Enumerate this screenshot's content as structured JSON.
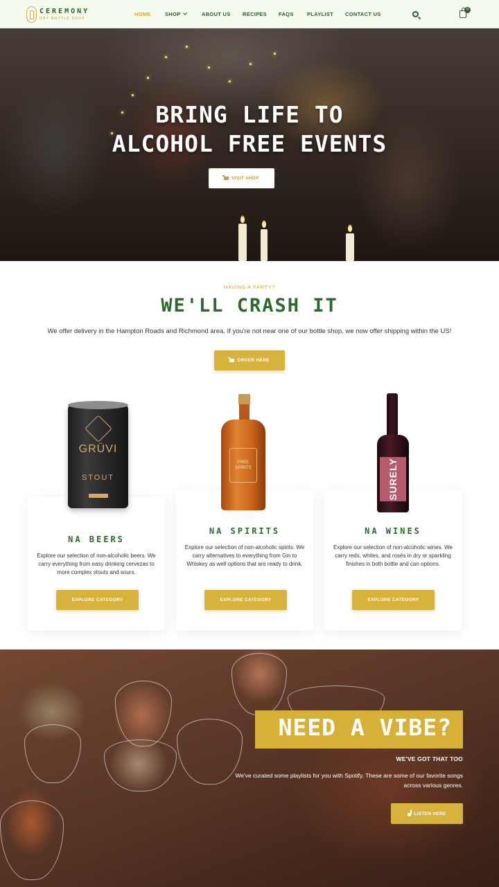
{
  "brand": {
    "title": "CEREMONY",
    "subtitle": "DRY BOTTLE SHOP"
  },
  "nav": {
    "items": [
      {
        "label": "HOME"
      },
      {
        "label": "SHOP"
      },
      {
        "label": "ABOUT US"
      },
      {
        "label": "RECIPES"
      },
      {
        "label": "FAQS"
      },
      {
        "label": "PLAYLIST"
      },
      {
        "label": "CONTACT US"
      }
    ],
    "cart_count": "0"
  },
  "hero": {
    "title_line1": "BRING LIFE TO",
    "title_line2": "ALCOHOL FREE EVENTS",
    "button_label": "VISIT SHOP"
  },
  "party": {
    "eyebrow": "HAVING A PARTY?",
    "title": "WE'LL CRASH IT",
    "description": "We offer delivery in the Hampton Roads and Richmond area. If you're not near one of our bottle shop, we now offer shipping within the US!",
    "button_label": "ORDER HERE"
  },
  "products": {
    "can": {
      "brand": "GRÜVI",
      "type": "STOUT"
    },
    "bottle": {
      "label": "FREE SPIRITS"
    },
    "wine": {
      "label": "SURELY"
    }
  },
  "categories": [
    {
      "title": "NA BEERS",
      "description": "Explore our selection of non-alcoholic beers. We carry everything from easy drinking cervezas to more complex stouts and sours.",
      "button_label": "EXPLORE CATEGORY"
    },
    {
      "title": "NA SPIRITS",
      "description": "Explore our selection of non-alcoholic spirits. We carry alternatives to everything from Gin to Whiskey as well options that are ready to drink.",
      "button_label": "EXPLORE CATEGORY"
    },
    {
      "title": "NA WINES",
      "description": "Explore our selection of non-alcoholic wines. We carry reds, whites, and rosés in dry or sparkling finishes in both bottle and can options.",
      "button_label": "EXPLORE CATEGORY"
    }
  ],
  "vibe": {
    "title": "NEED A VIBE?",
    "subtitle": "WE'VE GOT THAT TOO",
    "description": "We've curated some playlists for you with Spotify. These are some of our favorite songs across various genres.",
    "button_label": "LISTEN HERE"
  },
  "colors": {
    "accent_gold": "#d7b23c",
    "brand_green": "#2c6a2c",
    "nav_bg": "#f5fbef"
  },
  "icons": [
    "logo-icon",
    "chevron-down-icon",
    "search-icon",
    "cart-icon",
    "music-note-icon"
  ]
}
